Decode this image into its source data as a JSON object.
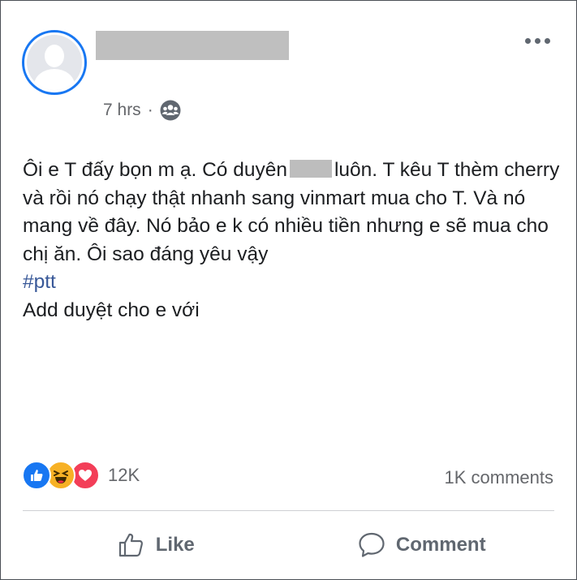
{
  "post": {
    "time": "7 hrs",
    "privacy_icon": "group-icon",
    "text_part1": "Ôi e T đấy bọn m ạ. Có duyên",
    "text_part2": "luôn. T kêu T thèm cherry và rồi nó chạy thật nhanh sang vinmart mua cho T. Và nó mang về đây. Nó bảo e k có nhiều tiền nhưng e sẽ mua cho chị ăn. Ôi sao đáng yêu vậy",
    "hashtag": "#ptt",
    "text_last": "Add duyệt cho e với"
  },
  "stats": {
    "reaction_icons": [
      "like-icon",
      "haha-icon",
      "love-icon"
    ],
    "reaction_count": "12K",
    "comment_count": "1K comments"
  },
  "actions": {
    "like_label": "Like",
    "comment_label": "Comment"
  },
  "colors": {
    "accent": "#1877f2",
    "hashtag": "#385898",
    "muted": "#65676b",
    "love": "#f33e58",
    "haha": "#f7b125"
  }
}
